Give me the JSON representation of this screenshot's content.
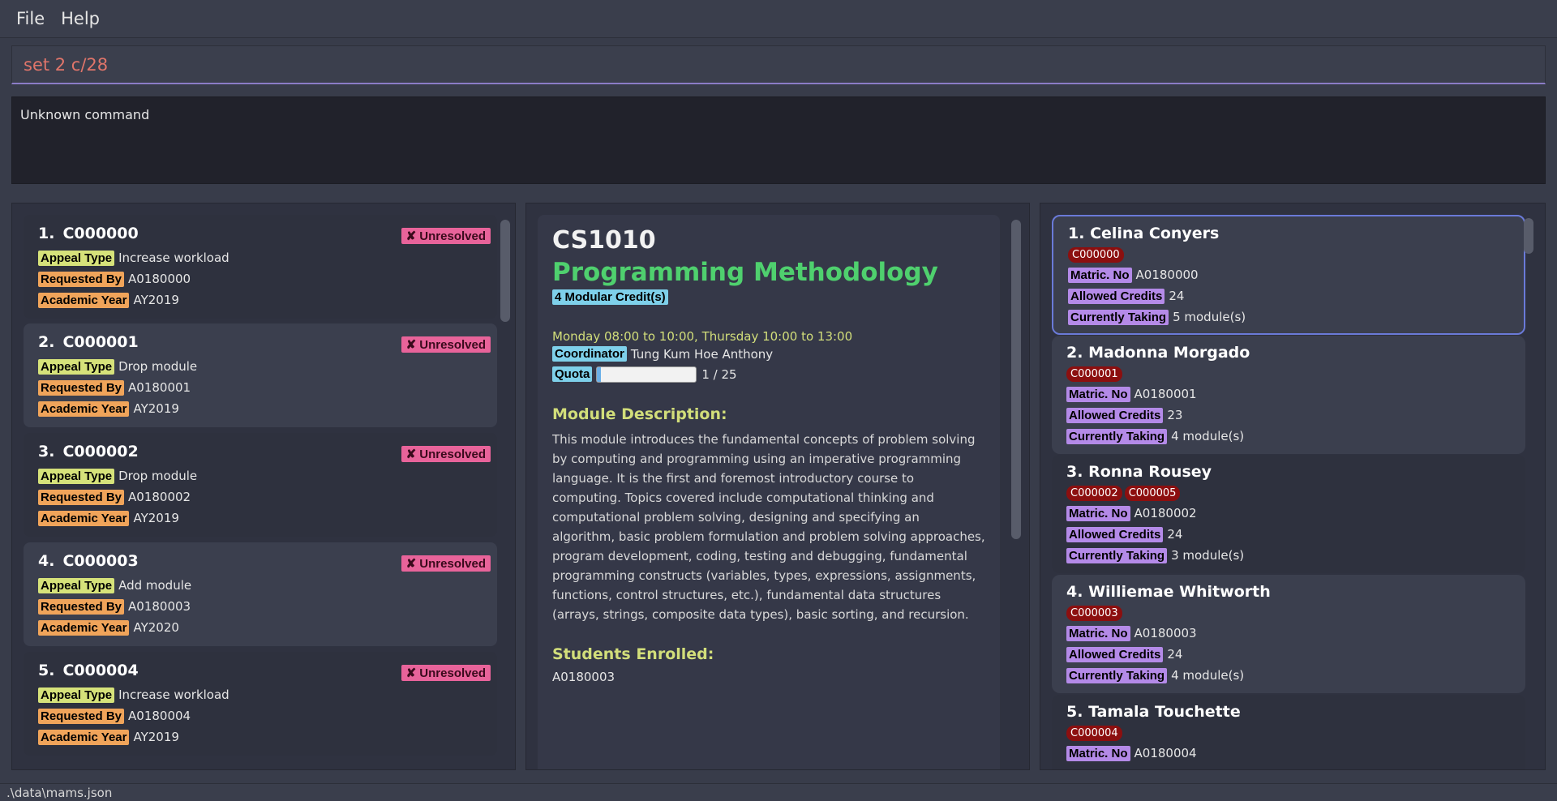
{
  "menu": {
    "file": "File",
    "help": "Help"
  },
  "command": {
    "value": "set 2 c/28"
  },
  "result": {
    "text": "Unknown command"
  },
  "appeals": [
    {
      "index": "1.",
      "id": "C000000",
      "status": "✘ Unresolved",
      "appeal_type": "Increase workload",
      "requested_by": "A0180000",
      "academic_year": "AY2019"
    },
    {
      "index": "2.",
      "id": "C000001",
      "status": "✘ Unresolved",
      "appeal_type": "Drop module",
      "requested_by": "A0180001",
      "academic_year": "AY2019"
    },
    {
      "index": "3.",
      "id": "C000002",
      "status": "✘ Unresolved",
      "appeal_type": "Drop module",
      "requested_by": "A0180002",
      "academic_year": "AY2019"
    },
    {
      "index": "4.",
      "id": "C000003",
      "status": "✘ Unresolved",
      "appeal_type": "Add module",
      "requested_by": "A0180003",
      "academic_year": "AY2020"
    },
    {
      "index": "5.",
      "id": "C000004",
      "status": "✘ Unresolved",
      "appeal_type": "Increase workload",
      "requested_by": "A0180004",
      "academic_year": "AY2019"
    }
  ],
  "labels": {
    "appeal_type": "Appeal Type",
    "requested_by": "Requested By",
    "academic_year": "Academic Year",
    "matric_no": "Matric. No",
    "allowed_credits": "Allowed Credits",
    "currently_taking": "Currently Taking",
    "modules_suffix": " module(s)",
    "coordinator": "Coordinator",
    "quota": "Quota"
  },
  "module": {
    "code": "CS1010",
    "name": "Programming Methodology",
    "credits": "4 Modular Credit(s)",
    "timeslot": "Monday 08:00 to 10:00, Thursday 10:00 to 13:00",
    "coordinator": "Tung Kum Hoe Anthony",
    "quota_text": "1 / 25",
    "quota_fraction": 0.04,
    "description_heading": "Module Description:",
    "description": "This module introduces the fundamental concepts of problem solving by computing and programming using an imperative programming language. It is the first and foremost introductory course to computing. Topics covered include computational thinking and computational problem solving, designing and specifying an algorithm, basic problem formulation and problem solving approaches, program development, coding, testing and debugging, fundamental programming constructs (variables, types, expressions, assignments, functions, control structures, etc.), fundamental data structures (arrays, strings, composite data types), basic sorting, and recursion.",
    "enrolled_heading": "Students Enrolled:",
    "enrolled": "A0180003"
  },
  "students": [
    {
      "index": "1.",
      "name": "Celina Conyers",
      "appeals": [
        "C000000"
      ],
      "matric": "A0180000",
      "credits": "24",
      "taking": "5"
    },
    {
      "index": "2.",
      "name": "Madonna Morgado",
      "appeals": [
        "C000001"
      ],
      "matric": "A0180001",
      "credits": "23",
      "taking": "4"
    },
    {
      "index": "3.",
      "name": "Ronna Rousey",
      "appeals": [
        "C000002",
        "C000005"
      ],
      "matric": "A0180002",
      "credits": "24",
      "taking": "3"
    },
    {
      "index": "4.",
      "name": "Williemae Whitworth",
      "appeals": [
        "C000003"
      ],
      "matric": "A0180003",
      "credits": "24",
      "taking": "4"
    },
    {
      "index": "5.",
      "name": "Tamala Touchette",
      "appeals": [
        "C000004"
      ],
      "matric": "A0180004",
      "credits": "",
      "taking": ""
    }
  ],
  "statusbar": {
    "path": ".\\data\\mams.json"
  }
}
